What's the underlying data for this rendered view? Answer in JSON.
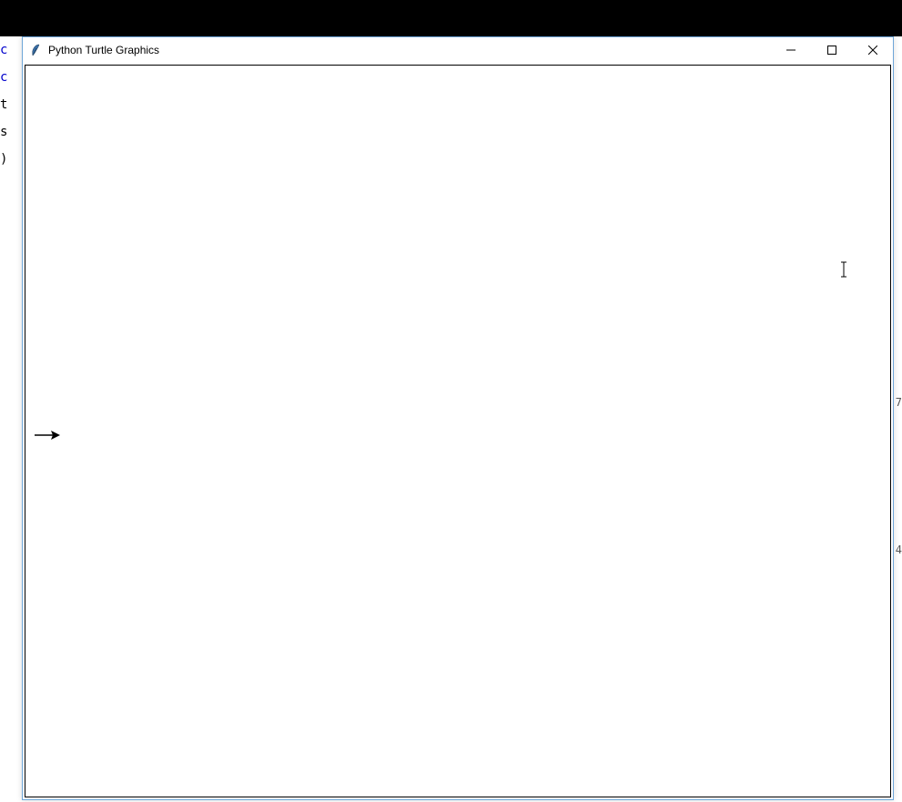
{
  "window": {
    "title": "Python Turtle Graphics"
  },
  "background": {
    "left_fragments": [
      "c",
      "c",
      "t",
      " ",
      "s",
      " ",
      " ",
      " ",
      " ",
      " ",
      " ",
      " ",
      " ",
      " ",
      ")",
      " ",
      " ",
      " ",
      " "
    ],
    "right_fragments": [
      "",
      "",
      "",
      "",
      "7",
      "",
      "",
      "",
      "",
      "",
      "4",
      "",
      "",
      "",
      ""
    ]
  }
}
